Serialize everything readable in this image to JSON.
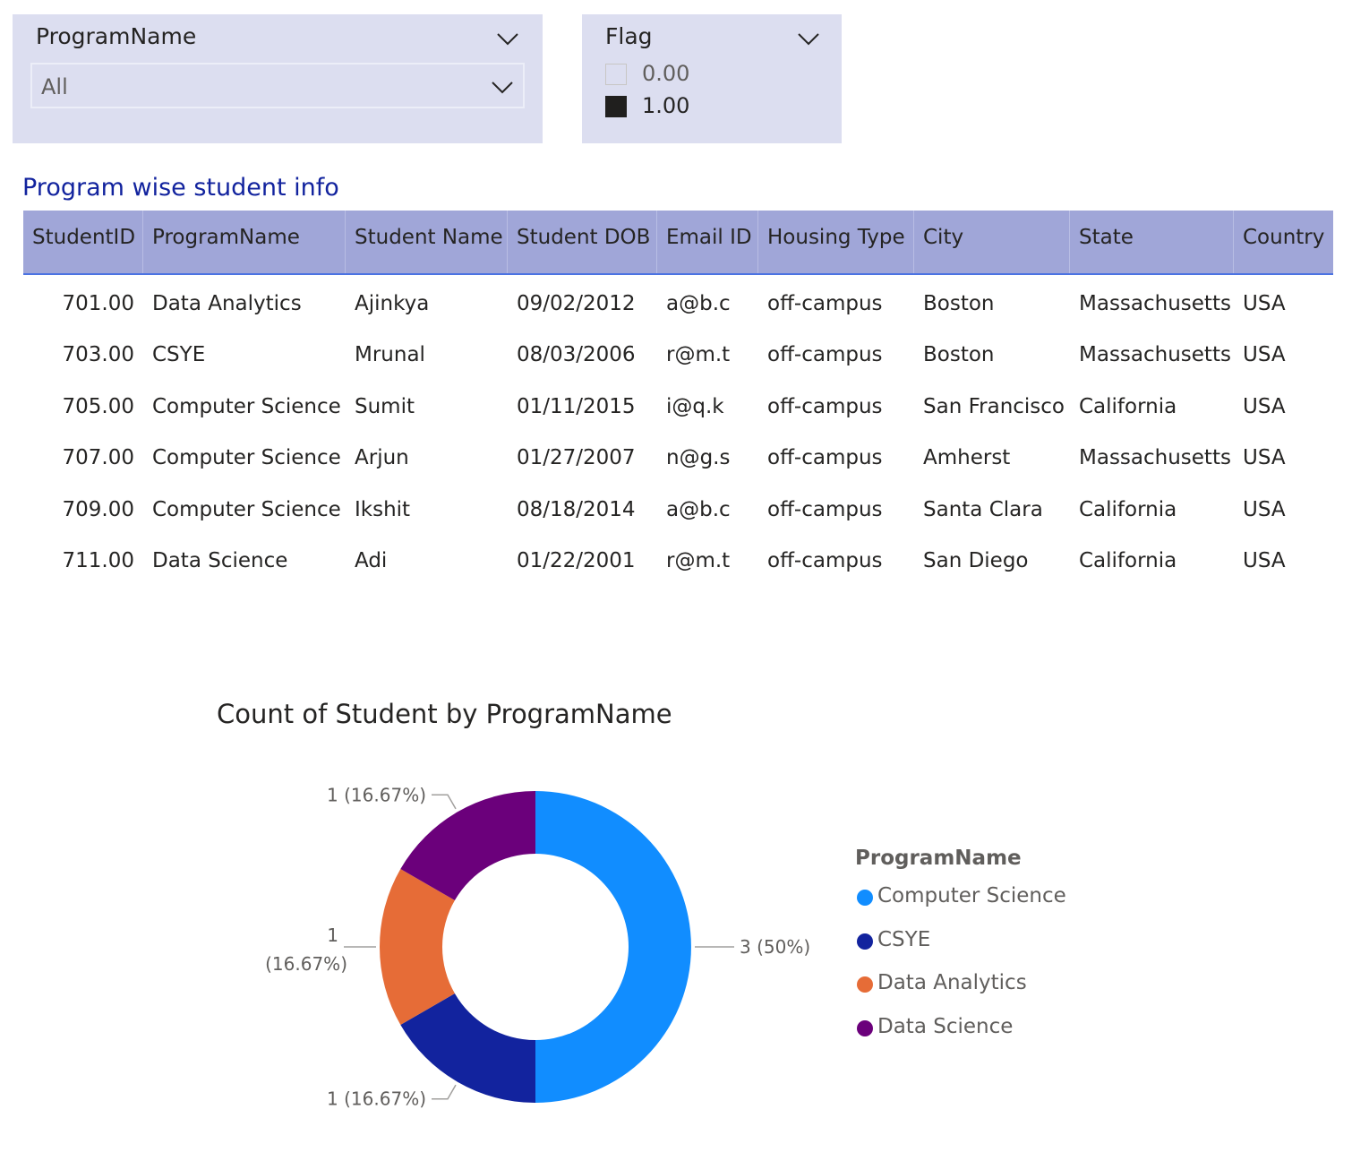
{
  "slicers": {
    "program": {
      "title": "ProgramName",
      "selected": "All"
    },
    "flag": {
      "title": "Flag",
      "items": [
        {
          "label": "0.00",
          "checked": false
        },
        {
          "label": "1.00",
          "checked": true
        }
      ]
    }
  },
  "table": {
    "title": "Program wise student info",
    "columns": [
      "StudentID",
      "ProgramName",
      "Student Name",
      "Student DOB",
      "Email ID",
      "Housing Type",
      "City",
      "State",
      "Country"
    ],
    "rows": [
      [
        "701.00",
        "Data Analytics",
        "Ajinkya",
        "09/02/2012",
        "a@b.c",
        "off-campus",
        "Boston",
        "Massachusetts",
        "USA"
      ],
      [
        "703.00",
        "CSYE",
        "Mrunal",
        "08/03/2006",
        "r@m.t",
        "off-campus",
        "Boston",
        "Massachusetts",
        "USA"
      ],
      [
        "705.00",
        "Computer Science",
        "Sumit",
        "01/11/2015",
        "i@q.k",
        "off-campus",
        "San Francisco",
        "California",
        "USA"
      ],
      [
        "707.00",
        "Computer Science",
        "Arjun",
        "01/27/2007",
        "n@g.s",
        "off-campus",
        "Amherst",
        "Massachusetts",
        "USA"
      ],
      [
        "709.00",
        "Computer Science",
        "Ikshit",
        "08/18/2014",
        "a@b.c",
        "off-campus",
        "Santa Clara",
        "California",
        "USA"
      ],
      [
        "711.00",
        "Data Science",
        "Adi",
        "01/22/2001",
        "r@m.t",
        "off-campus",
        "San Diego",
        "California",
        "USA"
      ]
    ]
  },
  "chart_data": {
    "type": "pie",
    "title": "Count of Student by ProgramName",
    "legend_title": "ProgramName",
    "legend_position": "right",
    "donut": true,
    "categories": [
      "Computer Science",
      "CSYE",
      "Data Analytics",
      "Data Science"
    ],
    "values": [
      3,
      1,
      1,
      1
    ],
    "labels": [
      "3 (50%)",
      "1 (16.67%)",
      "1 (16.67%)",
      "1 (16.67%)"
    ],
    "colors": [
      "#118dff",
      "#12239e",
      "#e66c37",
      "#6b007b"
    ]
  }
}
